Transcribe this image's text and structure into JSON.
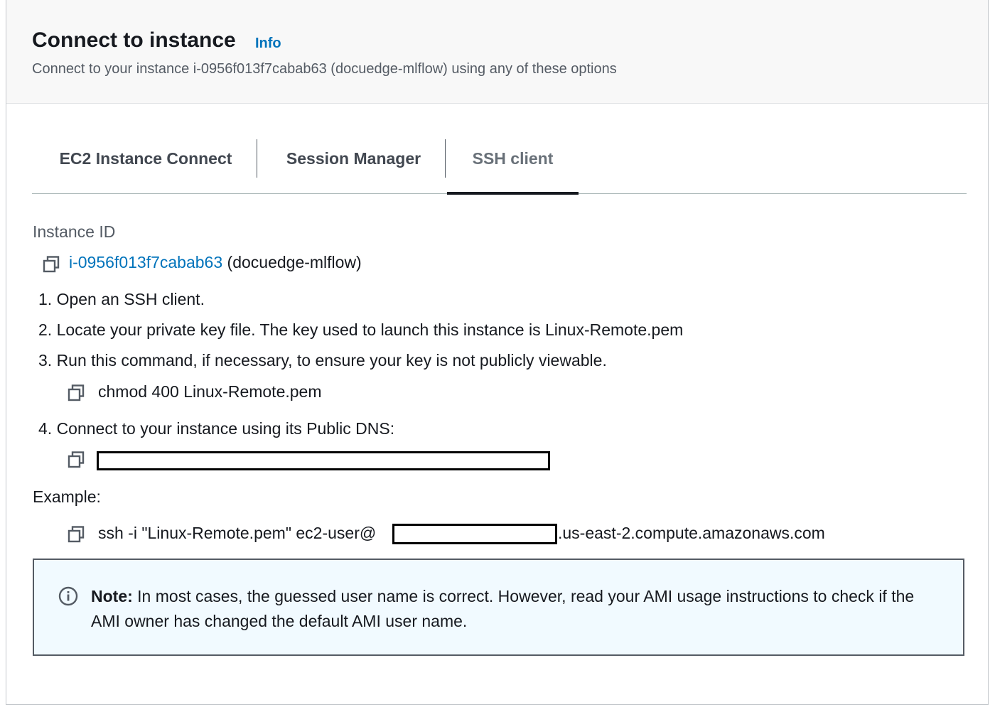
{
  "header": {
    "title": "Connect to instance",
    "info_link": "Info",
    "subtitle": "Connect to your instance i-0956f013f7cabab63 (docuedge-mlflow) using any of these options"
  },
  "tabs": [
    {
      "label": "EC2 Instance Connect",
      "active": false
    },
    {
      "label": "Session Manager",
      "active": false
    },
    {
      "label": "SSH client",
      "active": true
    }
  ],
  "instance": {
    "label": "Instance ID",
    "id": "i-0956f013f7cabab63",
    "name": "(docuedge-mlflow)"
  },
  "steps": [
    "1. Open an SSH client.",
    "2. Locate your private key file. The key used to launch this instance is Linux-Remote.pem",
    "3. Run this command, if necessary, to ensure your key is not publicly viewable.",
    "4. Connect to your instance using its Public DNS:"
  ],
  "chmod_command": "chmod 400 Linux-Remote.pem",
  "example": {
    "label": "Example:",
    "prefix": "ssh -i \"Linux-Remote.pem\" ec2-user@",
    "suffix": ".us-east-2.compute.amazonaws.com"
  },
  "note": {
    "bold": "Note:",
    "text": " In most cases, the guessed user name is correct. However, read your AMI usage instructions to check if the AMI owner has changed the default AMI user name."
  },
  "icons": {
    "copy": "copy-icon",
    "info": "info-circle-icon"
  },
  "colors": {
    "link": "#0073bb",
    "alert_bg": "#f1faff"
  }
}
